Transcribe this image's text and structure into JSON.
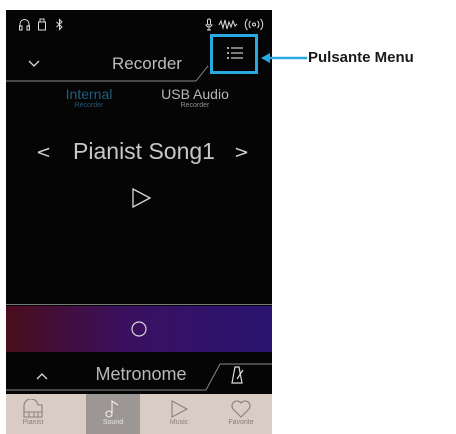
{
  "status_bar": {
    "icons": [
      "headphones-icon",
      "usb-memory-icon",
      "bluetooth-icon",
      "mic-icon",
      "audio-wave-icon",
      "wireless-icon"
    ]
  },
  "recorder": {
    "title": "Recorder",
    "tabs": [
      {
        "label": "Internal",
        "sublabel": "Recorder",
        "active": true
      },
      {
        "label": "USB Audio",
        "sublabel": "Recorder",
        "active": false
      }
    ],
    "song_title": "Pianist Song1",
    "prev_glyph": "<",
    "next_glyph": ">"
  },
  "metronome": {
    "title": "Metronome"
  },
  "nav": [
    {
      "label": "Pianist",
      "icon": "piano-icon",
      "active": false
    },
    {
      "label": "Sound",
      "icon": "music-note-icon",
      "active": true
    },
    {
      "label": "Music",
      "icon": "play-icon",
      "active": false
    },
    {
      "label": "Favorite",
      "icon": "heart-icon",
      "active": false
    }
  ],
  "callout": {
    "label": "Pulsante Menu"
  },
  "colors": {
    "highlight": "#2aa9e1",
    "screen_bg": "#050505",
    "nav_bg": "#d9ccc4",
    "nav_active": "#9c9694",
    "record_gradient_start": "#4a0d1c",
    "record_gradient_end": "#2a1470",
    "active_tab": "#1f5e7c"
  }
}
